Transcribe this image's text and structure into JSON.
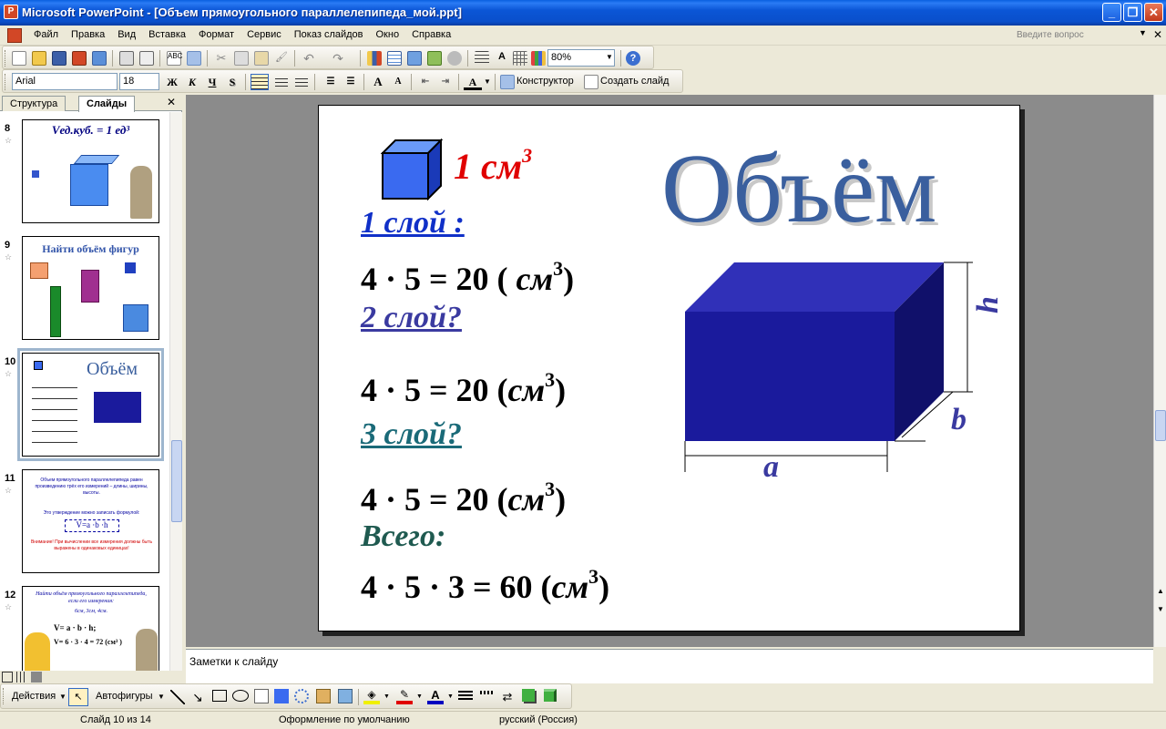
{
  "window": {
    "title": "Microsoft PowerPoint - [Объем прямоугольного параллелепипеда_мой.ppt]",
    "minimize": "_",
    "restore": "❐",
    "close": "✕"
  },
  "menu": {
    "items": [
      "Файл",
      "Правка",
      "Вид",
      "Вставка",
      "Формат",
      "Сервис",
      "Показ слайдов",
      "Окно",
      "Справка"
    ],
    "ask_placeholder": "Введите вопрос"
  },
  "standard_toolbar": {
    "zoom": "80%"
  },
  "formatting_toolbar": {
    "font": "Arial",
    "size": "18",
    "bold": "Ж",
    "italic": "К",
    "underline": "Ч",
    "shadow": "S",
    "design_label": "Конструктор",
    "new_slide_label": "Создать слайд"
  },
  "left_pane": {
    "tabs": [
      "Структура",
      "Слайды"
    ],
    "close": "✕",
    "thumbnails": [
      {
        "num": "8",
        "line1": "Vед.куб. = 1 ед³"
      },
      {
        "num": "9",
        "line1": "Найти объём фигур"
      },
      {
        "num": "10",
        "line1": "Объём"
      },
      {
        "num": "11",
        "line1": "Объем прямоугольного параллелепипеда равен произведению трёх его измерений – длины, ширины, высоты.",
        "line2": "Это утверждение можно записать формулой:",
        "formula": "V=a ·b ·h",
        "warning": "Внимание! При вычислении все измерения должны быть выражены в одинаковых единицах!"
      },
      {
        "num": "12",
        "line1": "Найти объём прямоугольного параллелепипеда, если его измерения:",
        "line2": "6см, 3см, 4см.",
        "formula1": "V= a · b · h;",
        "formula2": "V= 6 · 3 · 4 = 72 (см³ )"
      }
    ]
  },
  "slide": {
    "unit_label": "1 см",
    "unit_exp": "3",
    "title": "Объём",
    "layer1": "1 слой :",
    "layer2": "2 слой?",
    "layer3": "3 слой?",
    "total": "Всего:",
    "eq1_lhs": "4 · 5 = 20 ( ",
    "eq_unit": "см",
    "eq_exp": "3",
    "eq1_rhs": ")",
    "eq2_lhs": "4 · 5 = 20 (",
    "eq2_rhs": ")",
    "eq3_lhs": "4 · 5 = 20 (",
    "eq3_rhs": ")",
    "eq4_lhs": "4 · 5 · 3 = 60 (",
    "eq4_rhs": ")",
    "dim_a": "a",
    "dim_b": "b",
    "dim_h": "h"
  },
  "notes": {
    "placeholder": "Заметки к слайду"
  },
  "drawing_toolbar": {
    "actions": "Действия",
    "autoshapes": "Автофигуры"
  },
  "status": {
    "slide": "Слайд 10 из 14",
    "design": "Оформление по умолчанию",
    "language": "русский (Россия)"
  },
  "colors": {
    "title_blue": "#3A5F9E",
    "box_blue": "#1A1A9C",
    "red": "#E00000",
    "layer1": "#1030C8",
    "layer2": "#3A3AA0",
    "layer3": "#1A6A78",
    "total": "#1F5A50"
  }
}
